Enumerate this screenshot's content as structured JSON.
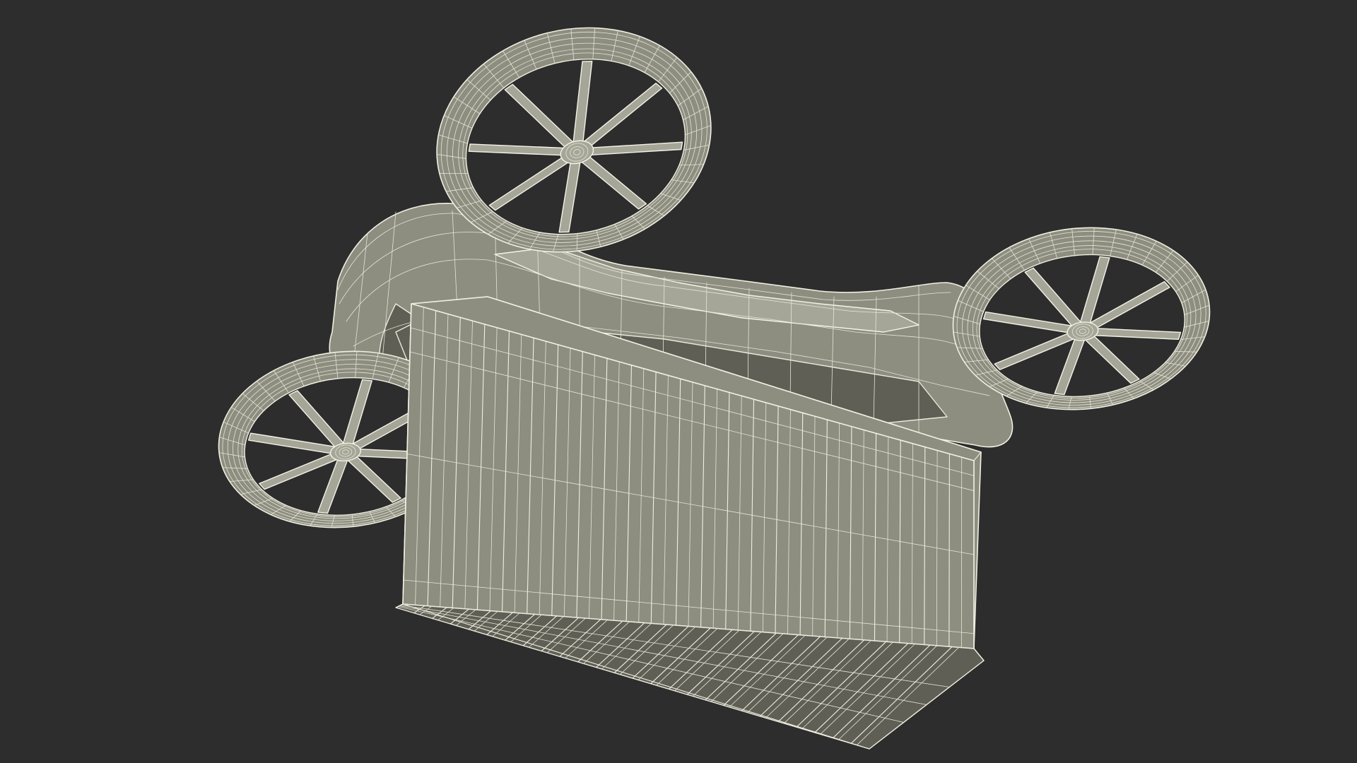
{
  "scene": {
    "background": "#2d2d2d",
    "model_fill": "#8d8d80",
    "wire_color": "#f1f0e2",
    "subject": "cargo-drone-wireframe",
    "rotor_count": 4,
    "visible_rotor_count": 3,
    "spokes_per_rotor": 8,
    "container_side_ribs": 46,
    "container_bottom_slats": 26
  }
}
